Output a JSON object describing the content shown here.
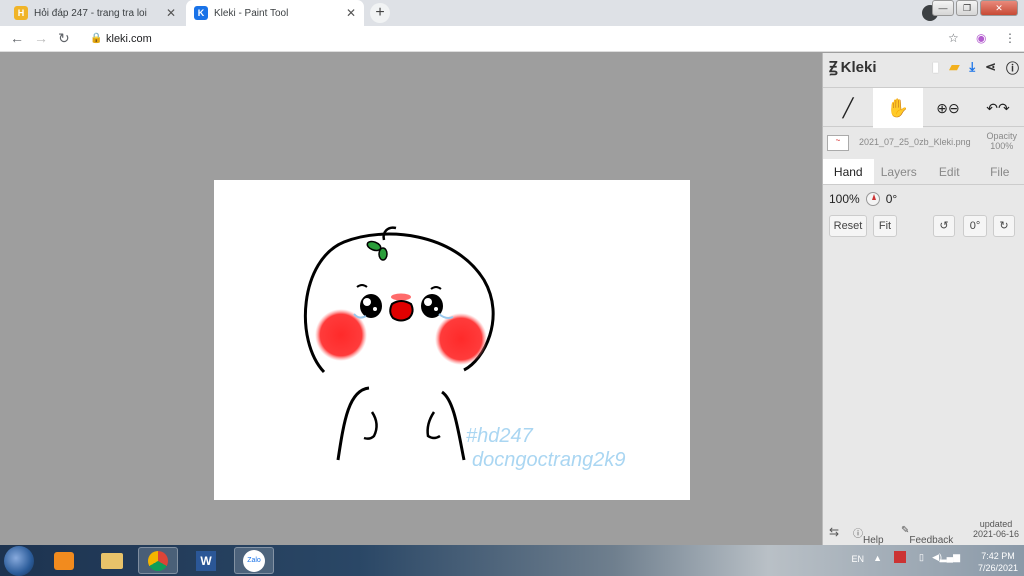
{
  "tabs": [
    {
      "title": "Hỏi đáp 247 - trang tra loi",
      "favicon": "H"
    },
    {
      "title": "Kleki - Paint Tool",
      "favicon": "K"
    }
  ],
  "address": {
    "url": "kleki.com"
  },
  "kleki": {
    "brand": "Kleki",
    "file": {
      "name": "2021_07_25_0zb_Kleki.png",
      "opacity_label": "Opacity",
      "opacity_value": "100%"
    },
    "panel_tabs": [
      "Hand",
      "Layers",
      "Edit",
      "File"
    ],
    "zoom": "100%",
    "rotation": "0°",
    "buttons": {
      "reset": "Reset",
      "fit": "Fit",
      "angle": "0°"
    },
    "footer": {
      "help": "Help",
      "feedback": "Feedback",
      "updated_label": "updated",
      "updated_date": "2021-06-16"
    }
  },
  "canvas": {
    "watermark_line1": "#hd247",
    "watermark_line2": "docngoctrang2k9"
  },
  "taskbar": {
    "lang": "EN",
    "time": "7:42 PM",
    "date": "7/26/2021",
    "zalo": "Zalo"
  },
  "colors": {
    "accent": "#1a73e8",
    "paper": "#ffffff",
    "blush": "#ff2a2a",
    "watermark": "#aad6f2"
  }
}
